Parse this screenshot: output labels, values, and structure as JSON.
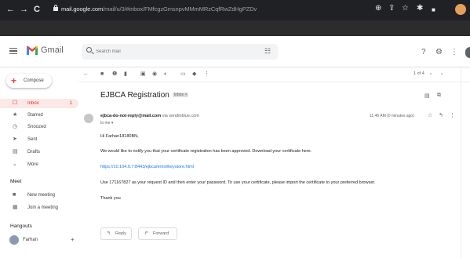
{
  "browser": {
    "url_host": "mail.google.com",
    "url_path": "/mail/u/3/#inbox/FMfcgzGmsnpvMMmMRzCqfRwZdHgPZDv",
    "nav": {
      "back": "←",
      "forward": "→",
      "reload": "C"
    },
    "icons": {
      "zoom": "⊕",
      "share": "⇪",
      "star": "☆",
      "extensions": "✱",
      "tab": "■"
    }
  },
  "gmail": {
    "brand": "Gmail",
    "search_placeholder": "Search mail",
    "header_icons": {
      "help": "?",
      "settings": "⚙"
    }
  },
  "sidebar": {
    "compose_label": "Compose",
    "items": [
      {
        "label": "Inbox",
        "icon": "☐",
        "count": "1"
      },
      {
        "label": "Starred",
        "icon": "★",
        "count": ""
      },
      {
        "label": "Snoozed",
        "icon": "◷",
        "count": ""
      },
      {
        "label": "Sent",
        "icon": "➤",
        "count": ""
      },
      {
        "label": "Drafts",
        "icon": "▤",
        "count": ""
      },
      {
        "label": "More",
        "icon": "⌄",
        "count": ""
      }
    ],
    "meet_title": "Meet",
    "meet_items": [
      {
        "label": "New meeting",
        "icon": "■"
      },
      {
        "label": "Join a meeting",
        "icon": "▦"
      }
    ],
    "hangouts_title": "Hangouts",
    "hangouts_user": "Farhan",
    "hangouts_add": "+"
  },
  "toolbar": {
    "back": "←",
    "pager": "1 of 4"
  },
  "message": {
    "subject": "EJBCA Registration",
    "label_badge": "Inbox ×",
    "sender_name": "ejbca-do-not-reply@mail.com",
    "sender_via": " via sendinblue.com",
    "to": "to me ▾",
    "time": "11:46 AM (0 minutes ago)",
    "body": [
      "Hi Farhan18180BN,",
      "We would like to notify you that your certificate registration has been approved. Download your certificate here.",
      "https://10.104.0.7:8443/ejbca/enrol/keystore.html",
      "Use 171167827 as your request ID and then enter your password. To use your certificate, please import the certificate to your preferred browser.",
      "Thank you"
    ],
    "reply_label": "Reply",
    "forward_label": "Forward"
  },
  "colors": {
    "chrome": "#202124",
    "inbox_active_bg": "#fce8e6",
    "inbox_active_text": "#d93025",
    "link": "#1a73e8"
  }
}
